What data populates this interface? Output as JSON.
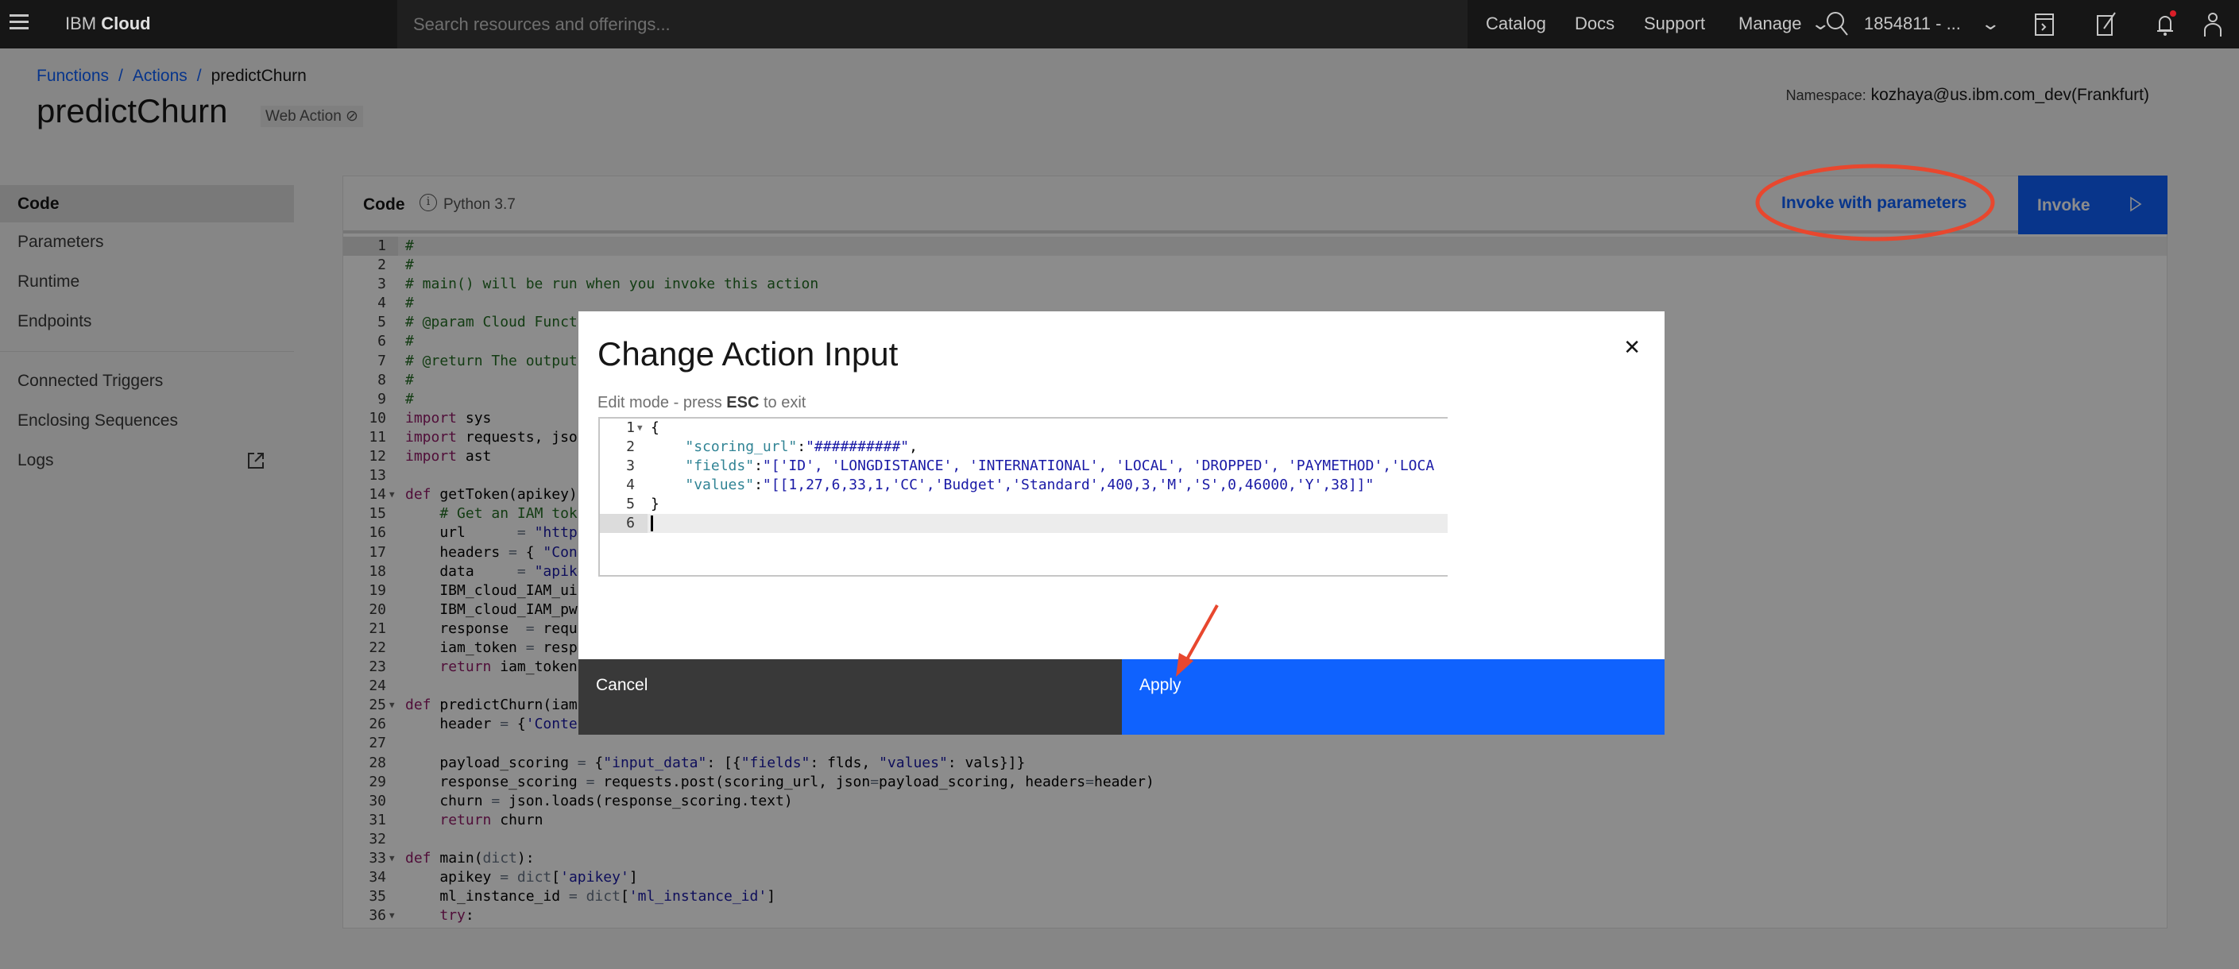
{
  "topbar": {
    "brand_prefix": "IBM",
    "brand_name": "Cloud",
    "search_placeholder": "Search resources and offerings...",
    "links": [
      "Catalog",
      "Docs",
      "Support",
      "Manage"
    ],
    "account": "1854811 - ...",
    "icons": [
      "menu-icon",
      "search-icon",
      "chevron-down-icon",
      "terminal-icon",
      "edit-icon",
      "notification-icon",
      "user-icon"
    ]
  },
  "breadcrumb": [
    "Functions",
    "Actions",
    "predictChurn"
  ],
  "header": {
    "title": "predictChurn",
    "web_action": "Web Action",
    "namespace_label": "Namespace:",
    "namespace_value": "kozhaya@us.ibm.com_dev(Frankfurt)"
  },
  "sidebar": {
    "items": [
      {
        "label": "Code",
        "active": true
      },
      {
        "label": "Parameters"
      },
      {
        "label": "Runtime"
      },
      {
        "label": "Endpoints"
      }
    ],
    "items2": [
      {
        "label": "Connected Triggers"
      },
      {
        "label": "Enclosing Sequences"
      },
      {
        "label": "Logs",
        "icon": "external-link-icon"
      }
    ]
  },
  "code_panel": {
    "title": "Code",
    "runtime": "Python 3.7",
    "invoke_params_label": "Invoke with parameters",
    "invoke_label": "Invoke",
    "lines": [
      [
        [
          "#",
          "c"
        ]
      ],
      [
        [
          "#",
          "c"
        ]
      ],
      [
        [
          "# main() will be run when you invoke this action",
          "c"
        ]
      ],
      [
        [
          "#",
          "c"
        ]
      ],
      [
        [
          "# @param Cloud Funct",
          "c"
        ]
      ],
      [
        [
          "#",
          "c"
        ]
      ],
      [
        [
          "# @return The output",
          "c"
        ]
      ],
      [
        [
          "#",
          "c"
        ]
      ],
      [
        [
          "#",
          "c"
        ]
      ],
      [
        [
          "import",
          "k"
        ],
        [
          " sys",
          "p"
        ]
      ],
      [
        [
          "import",
          "k"
        ],
        [
          " requests, jso",
          "p"
        ]
      ],
      [
        [
          "import",
          "k"
        ],
        [
          " ast",
          "p"
        ]
      ],
      [],
      [
        [
          "def",
          "k"
        ],
        [
          " getToken(apikey)",
          "p"
        ]
      ],
      [
        [
          "    ",
          "p"
        ],
        [
          "# Get an IAM tok",
          "c"
        ]
      ],
      [
        [
          "    url      ",
          "p"
        ],
        [
          "=",
          "o"
        ],
        [
          " \"https",
          "s"
        ]
      ],
      [
        [
          "    headers ",
          "p"
        ],
        [
          "=",
          "o"
        ],
        [
          " { ",
          "p"
        ],
        [
          "\"Con",
          "s"
        ]
      ],
      [
        [
          "    data     ",
          "p"
        ],
        [
          "=",
          "o"
        ],
        [
          " \"apike",
          "s"
        ]
      ],
      [
        [
          "    IBM_cloud_IAM_ui",
          "p"
        ]
      ],
      [
        [
          "    IBM_cloud_IAM_pw",
          "p"
        ]
      ],
      [
        [
          "    response  ",
          "p"
        ],
        [
          "=",
          "o"
        ],
        [
          " requ",
          "p"
        ]
      ],
      [
        [
          "    iam_token ",
          "p"
        ],
        [
          "=",
          "o"
        ],
        [
          " resp",
          "p"
        ]
      ],
      [
        [
          "    ",
          "p"
        ],
        [
          "return",
          "k"
        ],
        [
          " iam_token",
          "p"
        ]
      ],
      [],
      [
        [
          "def",
          "k"
        ],
        [
          " predictChurn(iam",
          "p"
        ]
      ],
      [
        [
          "    header ",
          "p"
        ],
        [
          "=",
          "o"
        ],
        [
          " {",
          "p"
        ],
        [
          "'Conte",
          "s"
        ]
      ],
      [],
      [
        [
          "    payload_scoring ",
          "p"
        ],
        [
          "=",
          "o"
        ],
        [
          " {",
          "p"
        ],
        [
          "\"input_data\"",
          "s"
        ],
        [
          ": [{",
          "p"
        ],
        [
          "\"fields\"",
          "s"
        ],
        [
          ": flds, ",
          "p"
        ],
        [
          "\"values\"",
          "s"
        ],
        [
          ": vals}]}",
          "p"
        ]
      ],
      [
        [
          "    response_scoring ",
          "p"
        ],
        [
          "=",
          "o"
        ],
        [
          " requests.post(scoring_url, json",
          "p"
        ],
        [
          "=",
          "o"
        ],
        [
          "payload_scoring, headers",
          "p"
        ],
        [
          "=",
          "o"
        ],
        [
          "header)",
          "p"
        ]
      ],
      [
        [
          "    churn ",
          "p"
        ],
        [
          "=",
          "o"
        ],
        [
          " json.loads(response_scoring.text)",
          "p"
        ]
      ],
      [
        [
          "    ",
          "p"
        ],
        [
          "return",
          "k"
        ],
        [
          " churn",
          "p"
        ]
      ],
      [],
      [
        [
          "def",
          "k"
        ],
        [
          " main(",
          "p"
        ],
        [
          "dict",
          "o"
        ],
        [
          "):",
          "p"
        ]
      ],
      [
        [
          "    apikey ",
          "p"
        ],
        [
          "=",
          "o"
        ],
        [
          " ",
          "p"
        ],
        [
          "dict",
          "o"
        ],
        [
          "[",
          "p"
        ],
        [
          "'apikey'",
          "s"
        ],
        [
          "]",
          "p"
        ]
      ],
      [
        [
          "    ml_instance_id ",
          "p"
        ],
        [
          "=",
          "o"
        ],
        [
          " ",
          "p"
        ],
        [
          "dict",
          "o"
        ],
        [
          "[",
          "p"
        ],
        [
          "'ml_instance_id'",
          "s"
        ],
        [
          "]",
          "p"
        ]
      ],
      [
        [
          "    ",
          "p"
        ],
        [
          "try",
          "k"
        ],
        [
          ":",
          "p"
        ]
      ]
    ],
    "fold_lines": [
      14,
      25,
      33,
      36
    ]
  },
  "modal": {
    "title": "Change Action Input",
    "hint_prefix": "Edit mode - press ",
    "hint_key": "ESC",
    "hint_suffix": " to exit",
    "close_icon": "close-icon",
    "json_lines": [
      [
        [
          "{",
          "p"
        ]
      ],
      [
        [
          "    ",
          "p"
        ],
        [
          "\"scoring_url\"",
          "b"
        ],
        [
          ":",
          "p"
        ],
        [
          "\"##########\"",
          "s"
        ],
        [
          ",",
          "p"
        ]
      ],
      [
        [
          "    ",
          "p"
        ],
        [
          "\"fields\"",
          "b"
        ],
        [
          ":",
          "p"
        ],
        [
          "\"['ID', 'LONGDISTANCE', 'INTERNATIONAL', 'LOCAL', 'DROPPED', 'PAYMETHOD','LOCA",
          "s"
        ]
      ],
      [
        [
          "    ",
          "p"
        ],
        [
          "\"values\"",
          "b"
        ],
        [
          ":",
          "p"
        ],
        [
          "\"[[1,27,6,33,1,'CC','Budget','Standard',400,3,'M','S',0,46000,'Y',38]]\"",
          "s"
        ]
      ],
      [
        [
          "}",
          "p"
        ]
      ],
      []
    ],
    "cancel_label": "Cancel",
    "apply_label": "Apply"
  },
  "colors": {
    "accent": "#0f62fe",
    "annotation": "#e8472e",
    "topbar": "#161616"
  }
}
